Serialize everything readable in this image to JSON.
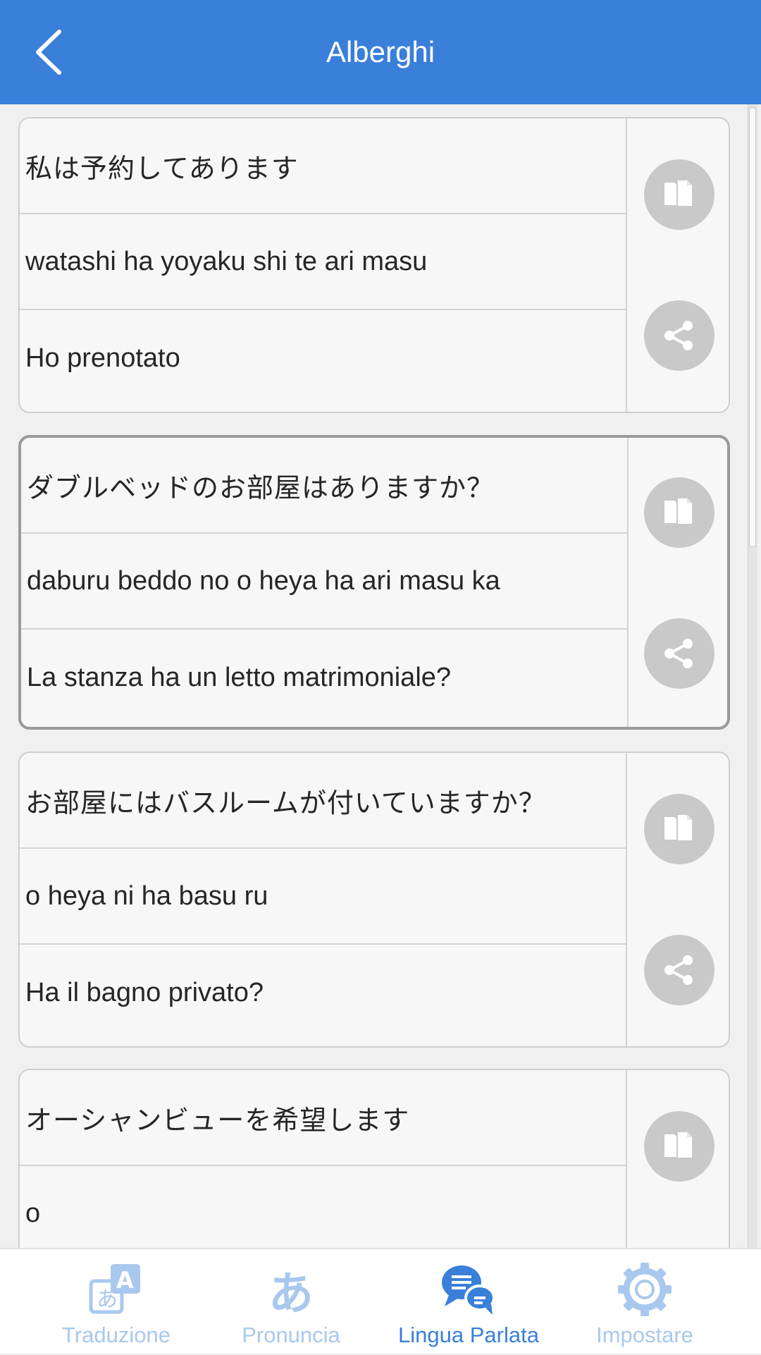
{
  "header": {
    "title": "Alberghi",
    "back_icon": "chevron-left-icon"
  },
  "phrases": [
    {
      "japanese": "私は予約してあります",
      "romaji": "watashi ha yoyaku shi te ari masu",
      "italian": "Ho prenotato"
    },
    {
      "japanese": "ダブルベッドのお部屋はありますか？",
      "romaji": "daburu beddo no o heya ha ari masu ka",
      "italian": "La stanza ha un letto matrimoniale?"
    },
    {
      "japanese": "お部屋にはバスルームが付いていますか？",
      "romaji": "o heya ni ha basu ru",
      "italian": "Ha il bagno privato?"
    },
    {
      "japanese": "オーシャンビューを希望します",
      "romaji": "o",
      "italian": ""
    }
  ],
  "card_actions": {
    "copy_icon": "copy-icon",
    "share_icon": "share-icon"
  },
  "tabs": [
    {
      "label": "Traduzione",
      "icon": "translate-icon",
      "active": false
    },
    {
      "label": "Pronuncia",
      "icon": "hiragana-a-icon",
      "active": false
    },
    {
      "label": "Lingua Parlata",
      "icon": "chat-bubbles-icon",
      "active": true
    },
    {
      "label": "Impostare",
      "icon": "gear-icon",
      "active": false
    }
  ],
  "colors": {
    "header_bg": "#3a7fd9",
    "tab_active": "#3a7fd9",
    "tab_inactive": "#a9c8ee",
    "action_button_bg": "#c9c9c9"
  }
}
